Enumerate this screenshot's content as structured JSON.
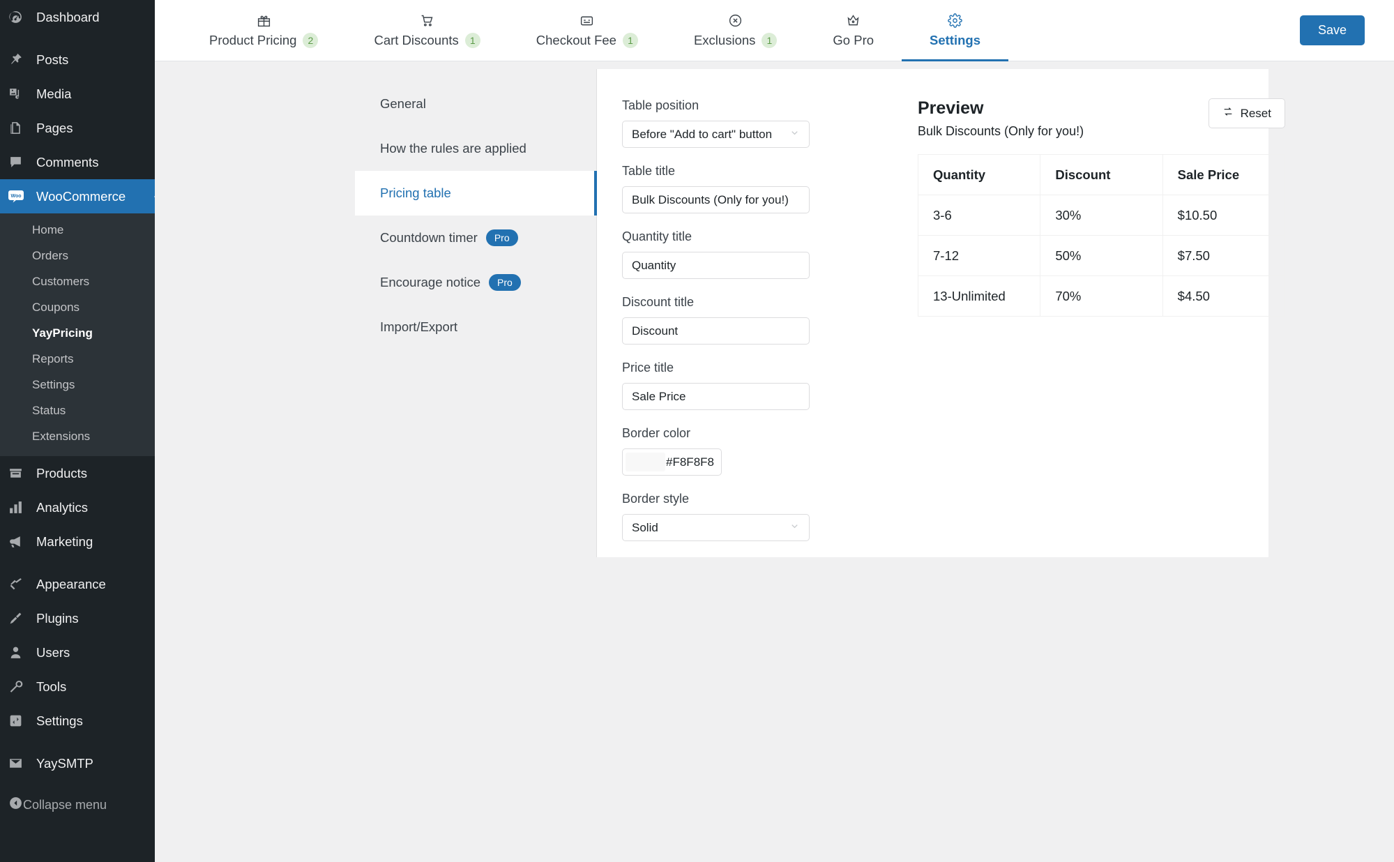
{
  "wp_sidebar": {
    "items": [
      {
        "label": "Dashboard",
        "icon": "dashboard-icon"
      },
      {
        "label": "Posts",
        "icon": "pin-icon"
      },
      {
        "label": "Media",
        "icon": "media-icon"
      },
      {
        "label": "Pages",
        "icon": "pages-icon"
      },
      {
        "label": "Comments",
        "icon": "comment-icon"
      }
    ],
    "current": {
      "label": "WooCommerce",
      "icon": "woo-icon"
    },
    "submenu": [
      {
        "label": "Home",
        "active": false
      },
      {
        "label": "Orders",
        "active": false
      },
      {
        "label": "Customers",
        "active": false
      },
      {
        "label": "Coupons",
        "active": false
      },
      {
        "label": "YayPricing",
        "active": true
      },
      {
        "label": "Reports",
        "active": false
      },
      {
        "label": "Settings",
        "active": false
      },
      {
        "label": "Status",
        "active": false
      },
      {
        "label": "Extensions",
        "active": false
      }
    ],
    "group2": [
      {
        "label": "Products",
        "icon": "products-icon"
      },
      {
        "label": "Analytics",
        "icon": "analytics-icon"
      },
      {
        "label": "Marketing",
        "icon": "marketing-icon"
      }
    ],
    "group3": [
      {
        "label": "Appearance",
        "icon": "appearance-icon"
      },
      {
        "label": "Plugins",
        "icon": "plugins-icon"
      },
      {
        "label": "Users",
        "icon": "users-icon"
      },
      {
        "label": "Tools",
        "icon": "tools-icon"
      },
      {
        "label": "Settings",
        "icon": "settings-icon"
      }
    ],
    "group4": [
      {
        "label": "YaySMTP",
        "icon": "mail-icon"
      }
    ],
    "collapse": {
      "label": "Collapse menu",
      "icon": "collapse-icon"
    }
  },
  "topbar": {
    "tabs": [
      {
        "label": "Product Pricing",
        "badge": "2",
        "icon": "gift-icon",
        "active": false
      },
      {
        "label": "Cart Discounts",
        "badge": "1",
        "icon": "cart-icon",
        "active": false
      },
      {
        "label": "Checkout Fee",
        "badge": "1",
        "icon": "checkout-icon",
        "active": false
      },
      {
        "label": "Exclusions",
        "badge": "1",
        "icon": "circle-x-icon",
        "active": false
      },
      {
        "label": "Go Pro",
        "badge": "",
        "icon": "crown-icon",
        "active": false
      },
      {
        "label": "Settings",
        "badge": "",
        "icon": "gear-icon",
        "active": true
      }
    ],
    "save_label": "Save",
    "accent_color": "#2271b1",
    "badge_bg": "#dcedd7",
    "badge_fg": "#5b9a47"
  },
  "settings_nav": {
    "items": [
      {
        "label": "General",
        "badge": "",
        "active": false
      },
      {
        "label": "How the rules are applied",
        "badge": "",
        "active": false
      },
      {
        "label": "Pricing table",
        "badge": "",
        "active": true
      },
      {
        "label": "Countdown timer",
        "badge": "Pro",
        "active": false
      },
      {
        "label": "Encourage notice",
        "badge": "Pro",
        "active": false
      },
      {
        "label": "Import/Export",
        "badge": "",
        "active": false
      }
    ]
  },
  "form": {
    "table_position": {
      "label": "Table position",
      "value": "Before \"Add to cart\" button",
      "type": "select"
    },
    "table_title": {
      "label": "Table title",
      "value": "Bulk Discounts (Only for you!)",
      "type": "input"
    },
    "quantity_title": {
      "label": "Quantity title",
      "value": "Quantity",
      "type": "input"
    },
    "discount_title": {
      "label": "Discount title",
      "value": "Discount",
      "type": "input"
    },
    "price_title": {
      "label": "Price title",
      "value": "Sale Price",
      "type": "input"
    },
    "border_color": {
      "label": "Border color",
      "value": "#F8F8F8",
      "swatch": "#F8F8F8",
      "type": "color"
    },
    "border_style": {
      "label": "Border style",
      "value": "Solid",
      "type": "select"
    }
  },
  "preview": {
    "title": "Preview",
    "subtitle": "Bulk Discounts (Only for you!)",
    "reset_label": "Reset",
    "table": {
      "headers": [
        "Quantity",
        "Discount",
        "Sale Price"
      ],
      "rows": [
        [
          "3-6",
          "30%",
          "$10.50"
        ],
        [
          "7-12",
          "50%",
          "$7.50"
        ],
        [
          "13-Unlimited",
          "70%",
          "$4.50"
        ]
      ]
    }
  }
}
